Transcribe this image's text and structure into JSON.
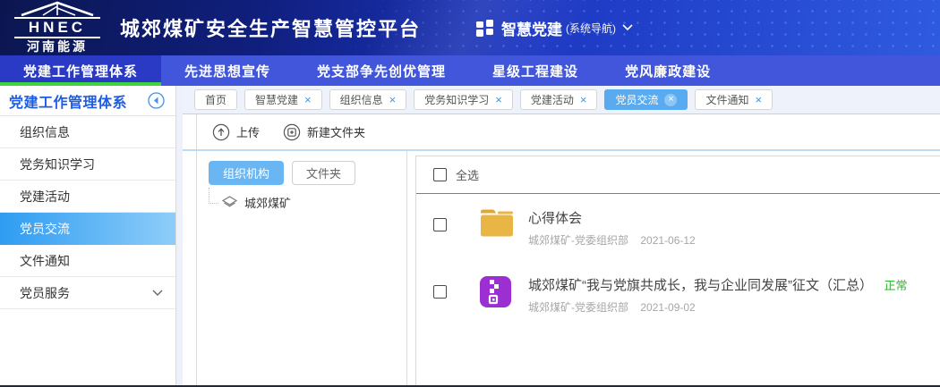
{
  "icons": {
    "close": "×"
  },
  "header": {
    "logo": {
      "acronym": "HNEC",
      "company": "河南能源"
    },
    "title": "城郊煤矿安全生产智慧管控平台",
    "system_nav": {
      "label": "智慧党建",
      "suffix": "(系统导航)"
    }
  },
  "navbar": {
    "items": [
      {
        "label": "党建工作管理体系",
        "active": true
      },
      {
        "label": "先进思想宣传",
        "active": false
      },
      {
        "label": "党支部争先创优管理",
        "active": false
      },
      {
        "label": "星级工程建设",
        "active": false
      },
      {
        "label": "党风廉政建设",
        "active": false
      }
    ]
  },
  "sidebar": {
    "title": "党建工作管理体系",
    "items": [
      {
        "label": "组织信息"
      },
      {
        "label": "党务知识学习"
      },
      {
        "label": "党建活动"
      },
      {
        "label": "党员交流",
        "active": true
      },
      {
        "label": "文件通知"
      },
      {
        "label": "党员服务",
        "expandable": true
      }
    ]
  },
  "tabstrip": {
    "tabs": [
      {
        "label": "首页",
        "closable": false
      },
      {
        "label": "智慧党建",
        "closable": true
      },
      {
        "label": "组织信息",
        "closable": true
      },
      {
        "label": "党务知识学习",
        "closable": true
      },
      {
        "label": "党建活动",
        "closable": true
      },
      {
        "label": "党员交流",
        "closable": true,
        "active": true
      },
      {
        "label": "文件通知",
        "closable": true
      }
    ]
  },
  "toolbar": {
    "upload_label": "上传",
    "new_folder_label": "新建文件夹"
  },
  "tree_panel": {
    "tabs": [
      {
        "label": "组织机构",
        "active": true
      },
      {
        "label": "文件夹",
        "active": false
      }
    ],
    "root_node": "城郊煤矿"
  },
  "file_list": {
    "select_all_label": "全选",
    "items": [
      {
        "type": "folder",
        "title": "心得体会",
        "source": "城郊煤矿-党委组织部",
        "date": "2021-06-12"
      },
      {
        "type": "zip",
        "title": "城郊煤矿“我与党旗共成长，我与企业同发展”征文（汇总）",
        "status": "正常",
        "source": "城郊煤矿-党委组织部",
        "date": "2021-09-02"
      }
    ]
  },
  "colors": {
    "accent_green": "#3fd43f",
    "navbar_blue": "#4156da",
    "active_tab_blue": "#58abf0",
    "folder_yellow": "#e9b544",
    "zip_purple": "#9c2fd2",
    "status_green": "#2eb52e"
  }
}
